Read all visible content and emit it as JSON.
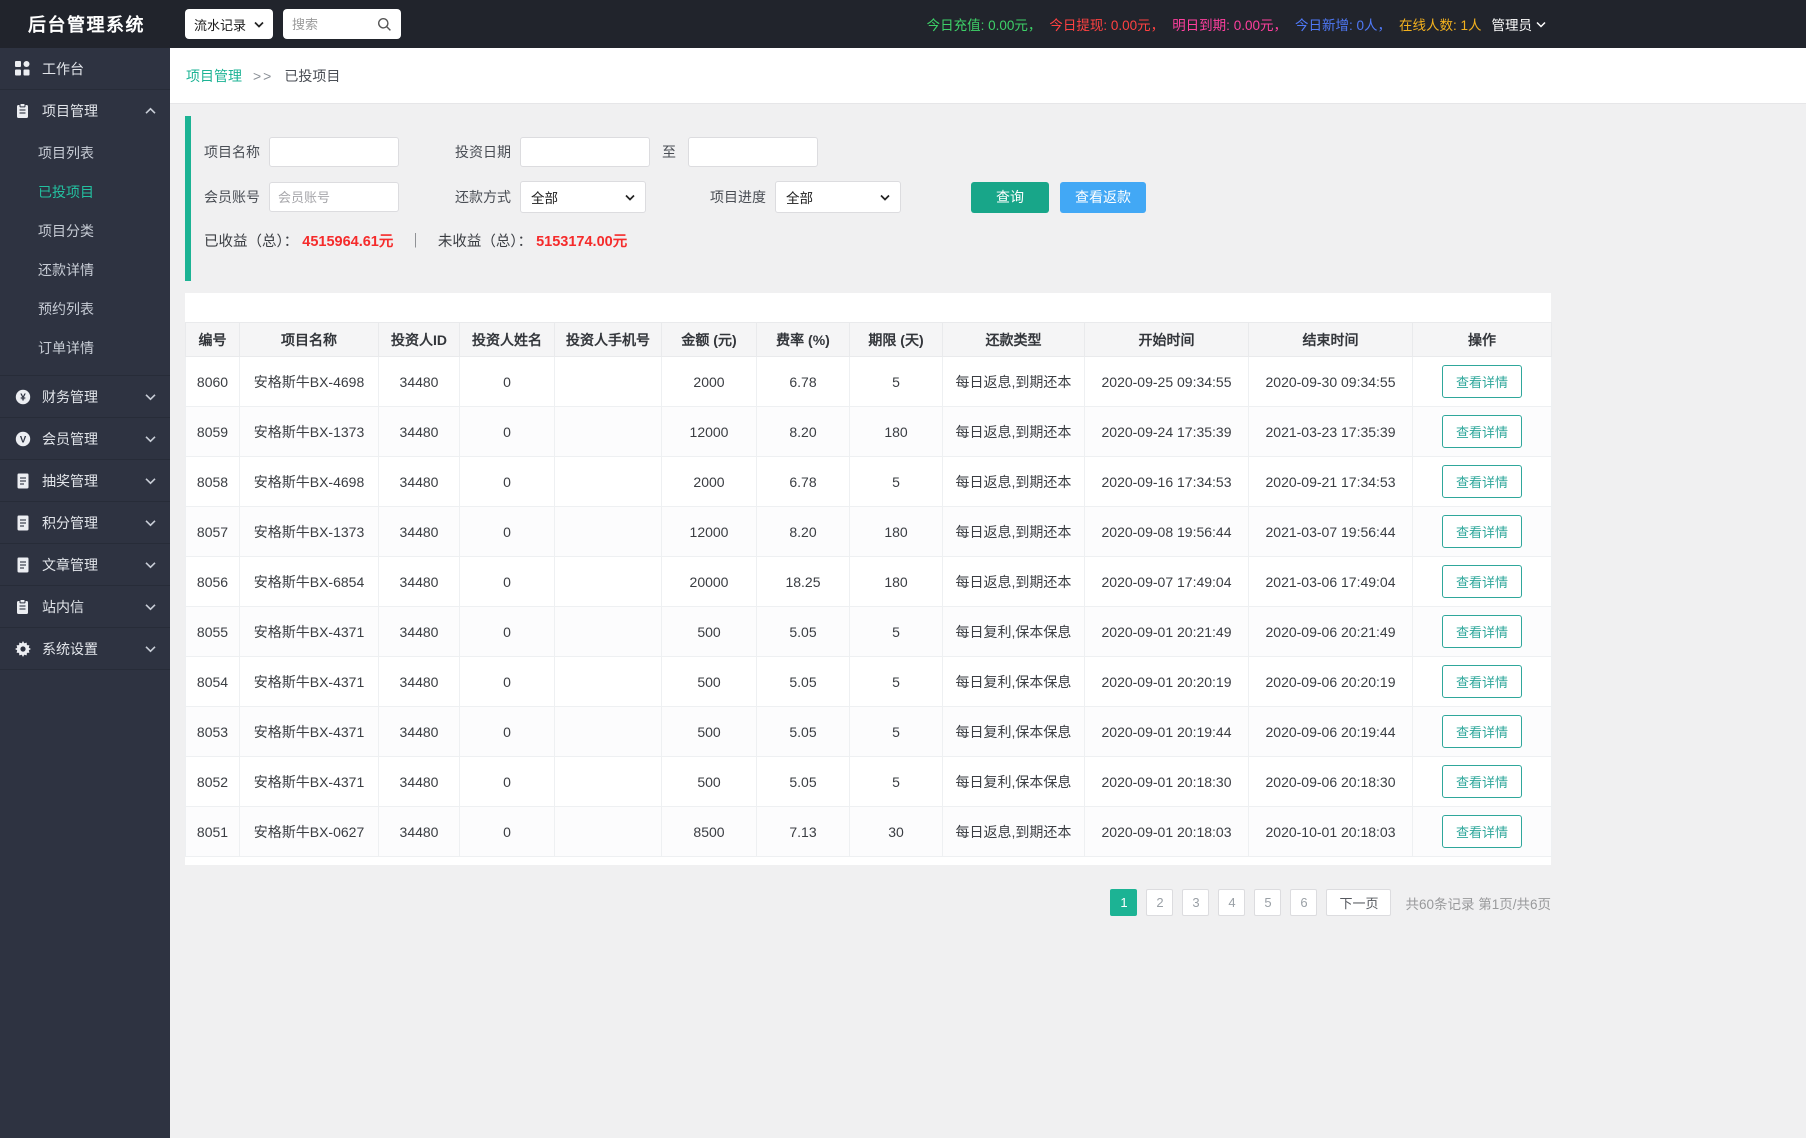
{
  "topbar": {
    "logo": "后台管理系统",
    "nav_select_value": "流水记录",
    "search_placeholder": "搜索",
    "stats": [
      {
        "label": "今日充值:",
        "value": "0.00元，",
        "color": "#3dd168"
      },
      {
        "label": "今日提现:",
        "value": "0.00元，",
        "color": "#ff4141"
      },
      {
        "label": "明日到期:",
        "value": "0.00元，",
        "color": "#ff3f9e"
      },
      {
        "label": "今日新增:",
        "value": "0人，",
        "color": "#4f79f8"
      },
      {
        "label": "在线人数:",
        "value": "1人",
        "color": "#f2b01e"
      }
    ],
    "admin_label": "管理员"
  },
  "sidebar": {
    "items": [
      {
        "id": "workbench",
        "icon": "dashboard-icon",
        "label": "工作台",
        "chevron": null
      },
      {
        "id": "project",
        "icon": "clipboard-icon",
        "label": "项目管理",
        "chevron": "up",
        "children": [
          "项目列表",
          "已投项目",
          "项目分类",
          "还款详情",
          "预约列表",
          "订单详情"
        ],
        "active_child": "已投项目"
      },
      {
        "id": "finance",
        "icon": "yen-circle-icon",
        "label": "财务管理",
        "chevron": "down"
      },
      {
        "id": "member",
        "icon": "v-circle-icon",
        "label": "会员管理",
        "chevron": "down"
      },
      {
        "id": "lottery",
        "icon": "document-icon",
        "label": "抽奖管理",
        "chevron": "down"
      },
      {
        "id": "points",
        "icon": "document-icon",
        "label": "积分管理",
        "chevron": "down"
      },
      {
        "id": "article",
        "icon": "document-icon",
        "label": "文章管理",
        "chevron": "down"
      },
      {
        "id": "mail",
        "icon": "clipboard-icon",
        "label": "站内信",
        "chevron": "down"
      },
      {
        "id": "settings",
        "icon": "gear-icon",
        "label": "系统设置",
        "chevron": "down"
      }
    ]
  },
  "breadcrumb": {
    "section": "项目管理",
    "separator": ">>",
    "current": "已投项目"
  },
  "filter": {
    "project_name_label": "项目名称",
    "invest_date_label": "投资日期",
    "to_label": "至",
    "member_account_label": "会员账号",
    "member_account_placeholder": "会员账号",
    "repay_method_label": "还款方式",
    "repay_method_value": "全部",
    "progress_label": "项目进度",
    "progress_value": "全部",
    "query_button": "查询",
    "view_refund_button": "查看返款"
  },
  "summary": {
    "earned_label": "已收益（总）：",
    "earned_value": "4515964.61元",
    "separator": "｜",
    "unearned_label": "未收益（总）：",
    "unearned_value": "5153174.00元"
  },
  "table": {
    "columns": [
      "编号",
      "项目名称",
      "投资人ID",
      "投资人姓名",
      "投资人手机号",
      "金额 (元)",
      "费率 (%)",
      "期限 (天)",
      "还款类型",
      "开始时间",
      "结束时间",
      "操作"
    ],
    "action_label": "查看详情",
    "rows": [
      [
        "8060",
        "安格斯牛BX-4698",
        "34480",
        "0",
        "",
        "2000",
        "6.78",
        "5",
        "每日返息,到期还本",
        "2020-09-25 09:34:55",
        "2020-09-30 09:34:55"
      ],
      [
        "8059",
        "安格斯牛BX-1373",
        "34480",
        "0",
        "",
        "12000",
        "8.20",
        "180",
        "每日返息,到期还本",
        "2020-09-24 17:35:39",
        "2021-03-23 17:35:39"
      ],
      [
        "8058",
        "安格斯牛BX-4698",
        "34480",
        "0",
        "",
        "2000",
        "6.78",
        "5",
        "每日返息,到期还本",
        "2020-09-16 17:34:53",
        "2020-09-21 17:34:53"
      ],
      [
        "8057",
        "安格斯牛BX-1373",
        "34480",
        "0",
        "",
        "12000",
        "8.20",
        "180",
        "每日返息,到期还本",
        "2020-09-08 19:56:44",
        "2021-03-07 19:56:44"
      ],
      [
        "8056",
        "安格斯牛BX-6854",
        "34480",
        "0",
        "",
        "20000",
        "18.25",
        "180",
        "每日返息,到期还本",
        "2020-09-07 17:49:04",
        "2021-03-06 17:49:04"
      ],
      [
        "8055",
        "安格斯牛BX-4371",
        "34480",
        "0",
        "",
        "500",
        "5.05",
        "5",
        "每日复利,保本保息",
        "2020-09-01 20:21:49",
        "2020-09-06 20:21:49"
      ],
      [
        "8054",
        "安格斯牛BX-4371",
        "34480",
        "0",
        "",
        "500",
        "5.05",
        "5",
        "每日复利,保本保息",
        "2020-09-01 20:20:19",
        "2020-09-06 20:20:19"
      ],
      [
        "8053",
        "安格斯牛BX-4371",
        "34480",
        "0",
        "",
        "500",
        "5.05",
        "5",
        "每日复利,保本保息",
        "2020-09-01 20:19:44",
        "2020-09-06 20:19:44"
      ],
      [
        "8052",
        "安格斯牛BX-4371",
        "34480",
        "0",
        "",
        "500",
        "5.05",
        "5",
        "每日复利,保本保息",
        "2020-09-01 20:18:30",
        "2020-09-06 20:18:30"
      ],
      [
        "8051",
        "安格斯牛BX-0627",
        "34480",
        "0",
        "",
        "8500",
        "7.13",
        "30",
        "每日返息,到期还本",
        "2020-09-01 20:18:03",
        "2020-10-01 20:18:03"
      ]
    ]
  },
  "pagination": {
    "pages": [
      "1",
      "2",
      "3",
      "4",
      "5",
      "6"
    ],
    "active_page": "1",
    "next_label": "下一页",
    "info": "共60条记录 第1页/共6页"
  },
  "colors": {
    "accent_teal": "#1cb394",
    "query_button": "#18a689",
    "refund_button": "#42a8f5",
    "summary_red": "#f52b2b",
    "topbar_bg": "#21242c",
    "sidebar_bg": "#2e3341"
  }
}
